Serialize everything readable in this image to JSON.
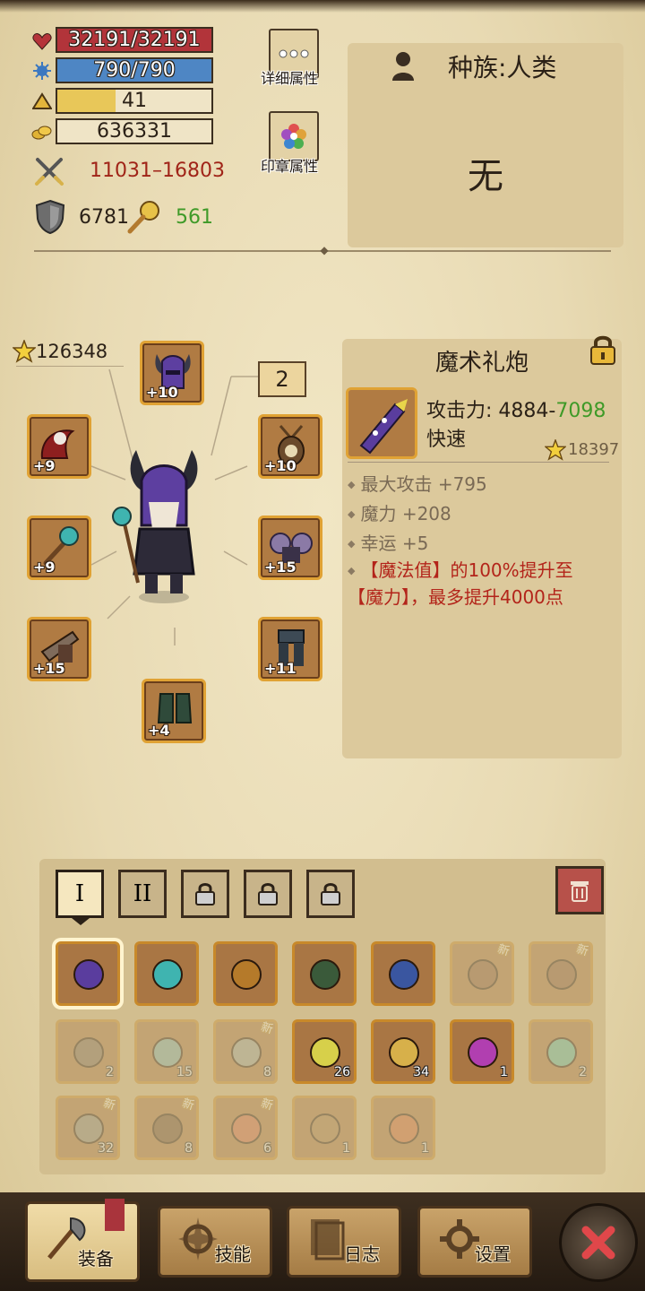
{
  "stats": {
    "hp": "32191/32191",
    "mp": "790/790",
    "level": "41",
    "gold": "636331",
    "attack_range": "11031–16803",
    "defense": "6781",
    "magic_defense": "561",
    "hp_ratio": 1.0,
    "mp_ratio": 1.0,
    "xp_ratio": 0.38
  },
  "buttons": {
    "detail_attributes": "详细属性",
    "seal_attributes": "印章属性"
  },
  "race_panel": {
    "race_label": "种族:人类",
    "value": "无"
  },
  "equipment": {
    "power_score": "126348",
    "badge_number": "2",
    "slots": {
      "head": "+10",
      "weapon_left": "+9",
      "chest_left": "+9",
      "offhand_left": "+15",
      "feet": "+4",
      "accessory_right": "+10",
      "shoulder_right": "+15",
      "legs_right": "+11"
    }
  },
  "item_detail": {
    "name": "魔术礼炮",
    "attack_label": "攻击力: 4884-",
    "attack_high": "7098",
    "speed": "快速",
    "score": "18397",
    "bonuses": [
      "最大攻击 +795",
      "魔力 +208",
      "幸运 +5"
    ],
    "special": "【魔法值】的100%提升至【魔力】，最多提升4000点"
  },
  "bag_tabs": [
    "I",
    "II"
  ],
  "inventory": {
    "row1": [
      {
        "count": "",
        "new": "",
        "faded": false
      },
      {
        "count": "",
        "new": "",
        "faded": false
      },
      {
        "count": "",
        "new": "",
        "faded": false
      },
      {
        "count": "",
        "new": "",
        "faded": false
      },
      {
        "count": "",
        "new": "",
        "faded": false
      },
      {
        "count": "",
        "new": "新",
        "faded": true
      },
      {
        "count": "",
        "new": "新",
        "faded": true
      }
    ],
    "row2": [
      {
        "count": "2",
        "new": "",
        "faded": true
      },
      {
        "count": "15",
        "new": "",
        "faded": true
      },
      {
        "count": "8",
        "new": "新",
        "faded": true
      },
      {
        "count": "26",
        "new": "",
        "faded": false
      },
      {
        "count": "34",
        "new": "",
        "faded": false
      },
      {
        "count": "1",
        "new": "",
        "faded": false
      },
      {
        "count": "2",
        "new": "",
        "faded": true
      }
    ],
    "row3": [
      {
        "count": "32",
        "new": "新",
        "faded": true
      },
      {
        "count": "8",
        "new": "新",
        "faded": true
      },
      {
        "count": "6",
        "new": "新",
        "faded": true
      },
      {
        "count": "1",
        "new": "",
        "faded": true
      },
      {
        "count": "1",
        "new": "",
        "faded": true
      }
    ]
  },
  "nav": {
    "equip": "装备",
    "skills": "技能",
    "log": "日志",
    "settings": "设置"
  },
  "colors": {
    "hp": "#b2343a",
    "mp": "#4e86c4",
    "xp": "#e8c759",
    "attack_range": "#a02418",
    "magic_def": "#3f9a28",
    "special": "#b3241a"
  }
}
